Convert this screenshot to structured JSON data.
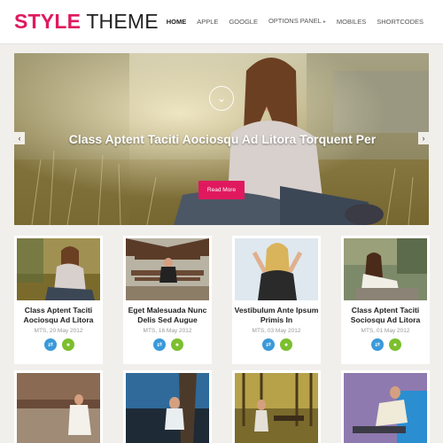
{
  "header": {
    "logo_part1": "STYLE",
    "logo_part2": "THEME",
    "nav": [
      "HOME",
      "APPLE",
      "GOOGLE",
      "OPTIONS PANEL",
      "MOBILES",
      "SHORTCODES"
    ],
    "nav_active": "HOME"
  },
  "slider": {
    "title": "Class Aptent Taciti Aociosqu Ad Litora Torquent Per",
    "button_label": "Read More",
    "down_icon": "chevron-down-icon",
    "prev_icon": "chevron-left-icon",
    "next_icon": "chevron-right-icon"
  },
  "posts": [
    {
      "title": "Class Aptent Taciti Aociosqu Ad Litora",
      "meta": "MTS, 20 May 2012"
    },
    {
      "title": "Eget Malesuada Nunc Delis Sed Augue",
      "meta": "MTS, 16 May 2012"
    },
    {
      "title": "Vestibulum Ante Ipsum Primis In",
      "meta": "MTS, 03 May 2012"
    },
    {
      "title": "Class Aptent Taciti Sociosqu Ad Litora",
      "meta": "MTS, 01 May 2012"
    }
  ],
  "colors": {
    "accent": "#e0195f",
    "share": "#3a9ad9",
    "comment": "#7cbf2f"
  }
}
